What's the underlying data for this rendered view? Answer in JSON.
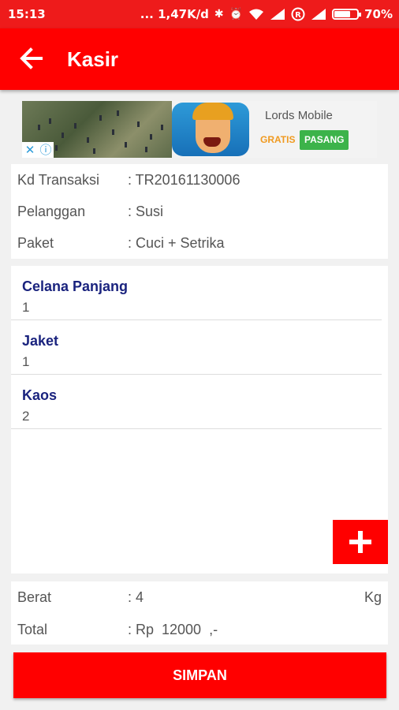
{
  "status_bar": {
    "time": "15:13",
    "network_speed": "... 1,47K/d",
    "battery": "70%",
    "battery_level": 0.7,
    "icons": [
      "bluetooth-icon",
      "alarm-icon",
      "wifi-icon",
      "signal-icon",
      "roaming-icon",
      "signal-icon",
      "battery-icon"
    ]
  },
  "app_bar": {
    "title": "Kasir",
    "back_icon": "arrow-left-icon",
    "color": "#ff0000"
  },
  "ad": {
    "game_name": "Lords Mobile",
    "free_label": "GRATIS",
    "install_label": "PASANG",
    "close_glyph": "✕",
    "info_glyph": "ⓘ"
  },
  "transaction": {
    "id": {
      "label": "Kd Transaksi",
      "value": ": TR20161130006"
    },
    "customer": {
      "label": "Pelanggan",
      "value": ": Susi"
    },
    "package": {
      "label": "Paket",
      "value": ": Cuci + Setrika"
    }
  },
  "items": [
    {
      "name": "Celana Panjang",
      "qty": "1"
    },
    {
      "name": "Jaket",
      "qty": "1"
    },
    {
      "name": "Kaos",
      "qty": "2"
    }
  ],
  "add_button_icon": "plus-icon",
  "summary": {
    "weight": {
      "label": "Berat",
      "value": ": 4",
      "unit": "Kg"
    },
    "total": {
      "label": "Total",
      "value": ": Rp  12000  ,-"
    }
  },
  "save_label": "SIMPAN",
  "colors": {
    "accent": "#ff0000",
    "item_name": "#1a237e",
    "ad_install": "#3cb34a",
    "ad_free": "#f09a20"
  }
}
